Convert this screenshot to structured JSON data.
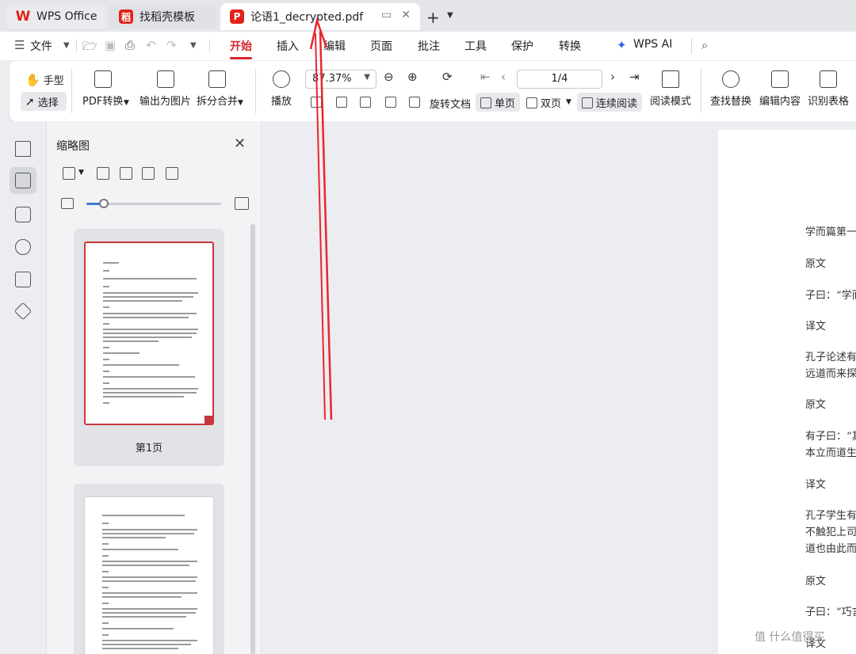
{
  "tabs": [
    {
      "label": "WPS Office"
    },
    {
      "label": "找稻壳模板"
    },
    {
      "label": "论语1_decrypted.pdf"
    }
  ],
  "menu": {
    "file": "文件",
    "items": [
      "开始",
      "插入",
      "编辑",
      "页面",
      "批注",
      "工具",
      "保护",
      "转换"
    ],
    "ai": "WPS AI"
  },
  "ribbon": {
    "hand": "手型",
    "select": "选择",
    "pdf_convert": "PDF转换",
    "export_image": "输出为图片",
    "split_merge": "拆分合并",
    "play": "播放",
    "zoom": "87.37%",
    "page": "1/4",
    "rotate": "旋转文档",
    "single": "单页",
    "double": "双页",
    "continuous": "连续阅读",
    "read_mode": "阅读模式",
    "find_replace": "查找替换",
    "edit_content": "编辑内容",
    "recognize_table": "识别表格"
  },
  "thumbnails": {
    "title": "缩略图",
    "pages": [
      {
        "caption": "第1页"
      }
    ]
  },
  "document_lines": [
    "学而篇第一",
    "原文",
    "子曰：“学而",
    "译文",
    "孔子论述有",
    "远道而来探",
    "原文",
    "有子曰：“其",
    "本立而道生",
    "译文",
    "孔子学生有",
    "不触犯上司",
    "道也由此而",
    "原文",
    "子曰：“巧言",
    "译文"
  ],
  "watermark": "值 什么值得买",
  "colors": {
    "accent": "#d8262e",
    "annotation": "#e8262e"
  }
}
